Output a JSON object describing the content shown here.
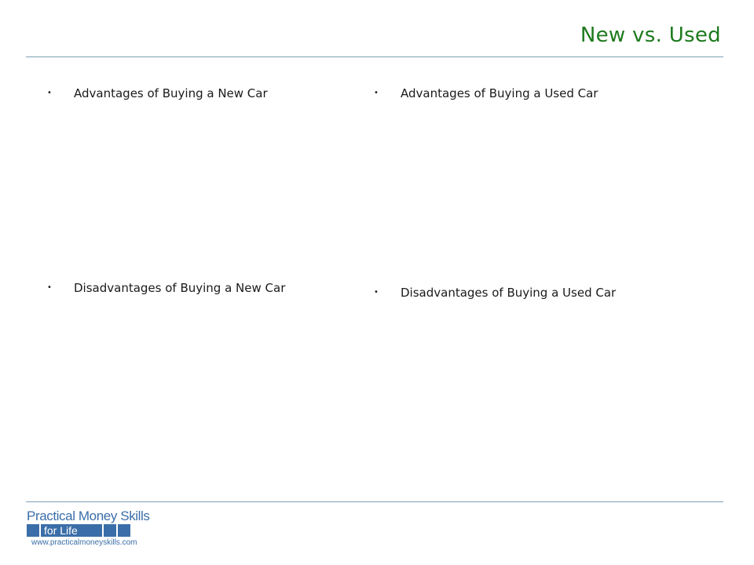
{
  "slide": {
    "title": "New vs. Used"
  },
  "bullets": {
    "marker": "•",
    "new_advantages": "Advantages of Buying a New Car",
    "used_advantages": "Advantages of Buying a Used Car",
    "new_disadvantages": "Disadvantages of Buying a New Car",
    "used_disadvantages": "Disadvantages of Buying a Used Car"
  },
  "logo": {
    "name": "Practical Money Skills",
    "tagline": "for Life",
    "url": "www.practicalmoneyskills.com",
    "color": "#3b6ea8"
  },
  "colors": {
    "title": "#1e7a1e",
    "rule": "#7f9fb5"
  }
}
